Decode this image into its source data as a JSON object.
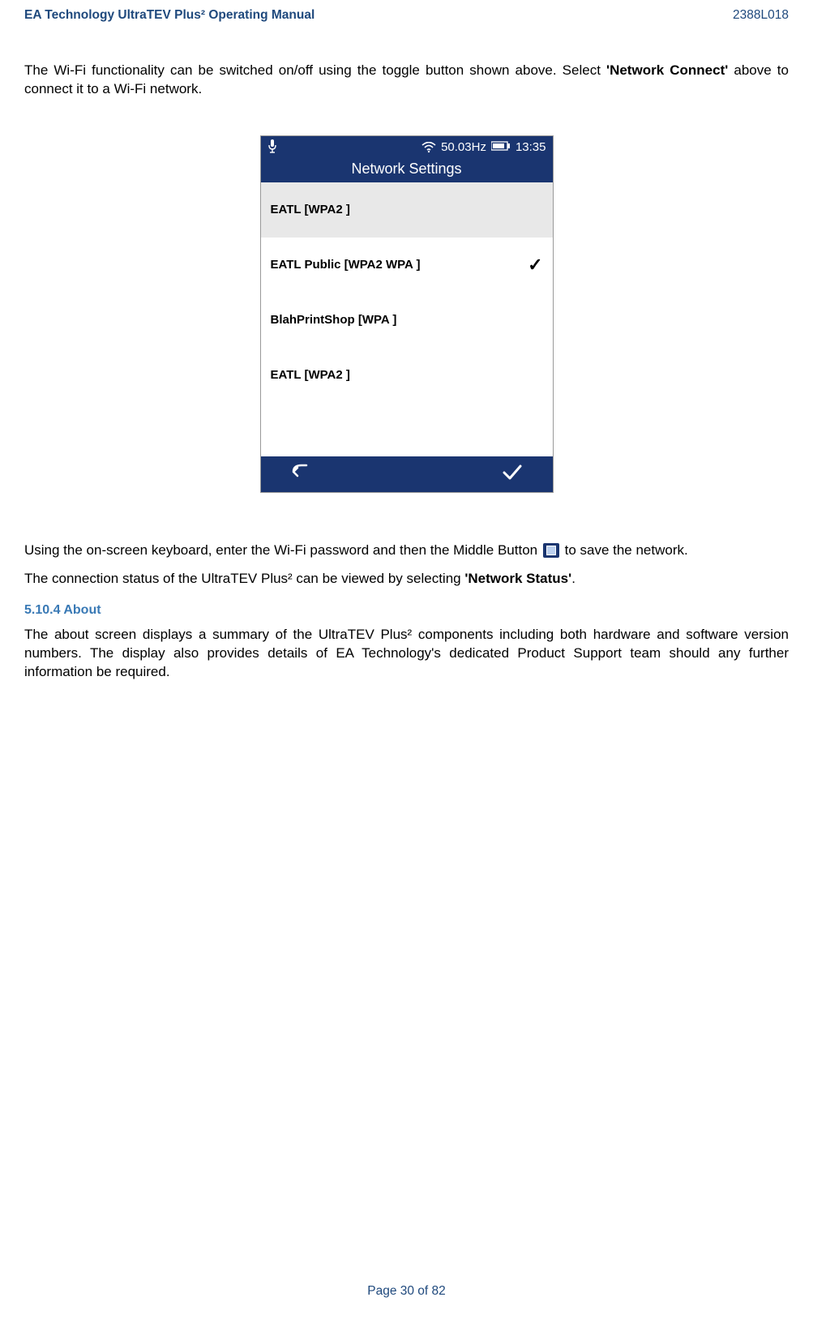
{
  "header": {
    "left": "EA Technology UltraTEV Plus² Operating Manual",
    "right": "2388L018"
  },
  "intro_para_prefix": "The Wi-Fi functionality can be switched on/off using the toggle button shown above. Select ",
  "intro_bold": "'Network Connect'",
  "intro_para_suffix": " above to connect it to a Wi-Fi network.",
  "device": {
    "status": {
      "freq": "50.03Hz",
      "time": "13:35"
    },
    "title": "Network Settings",
    "networks": [
      {
        "label": "EATL [WPA2 ]",
        "selected": true,
        "checked": false
      },
      {
        "label": "EATL Public [WPA2 WPA ]",
        "selected": false,
        "checked": true
      },
      {
        "label": "BlahPrintShop [WPA ]",
        "selected": false,
        "checked": false
      },
      {
        "label": "EATL [WPA2 ]",
        "selected": false,
        "checked": false
      }
    ]
  },
  "para2_prefix": "Using the on-screen keyboard, enter the Wi-Fi password and then the Middle Button",
  "para2_suffix": "to save the network.",
  "para3_prefix": "The connection status of the UltraTEV Plus² can be viewed by selecting ",
  "para3_bold": "'Network Status'",
  "para3_suffix": ".",
  "section_5_10_4": {
    "heading": "5.10.4 About",
    "body": "The about screen displays a summary of the UltraTEV Plus² components including both hardware and software version numbers. The display also provides details of EA Technology's dedicated Product Support team should any further information be required."
  },
  "footer": "Page 30 of 82"
}
